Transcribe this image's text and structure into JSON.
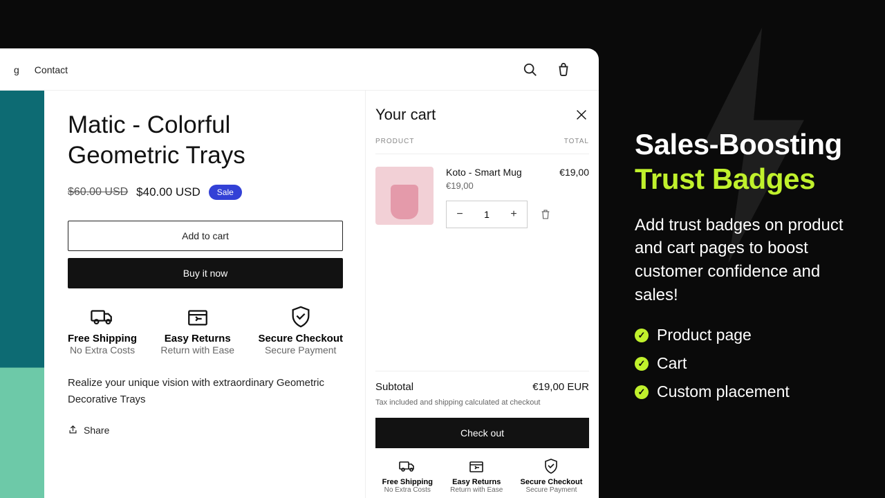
{
  "nav": {
    "links": [
      "g",
      "Contact"
    ]
  },
  "product": {
    "title": "Matic - Colorful Geometric Trays",
    "old_price": "$60.00 USD",
    "new_price": "$40.00 USD",
    "sale_label": "Sale",
    "add_to_cart": "Add to cart",
    "buy_now": "Buy it now",
    "description": "Realize your unique vision with extraordinary Geometric Decorative Trays",
    "share_label": "Share"
  },
  "badges": [
    {
      "title": "Free Shipping",
      "sub": "No Extra Costs"
    },
    {
      "title": "Easy Returns",
      "sub": "Return with Ease"
    },
    {
      "title": "Secure Checkout",
      "sub": "Secure Payment"
    }
  ],
  "cart": {
    "title": "Your cart",
    "col_product": "PRODUCT",
    "col_total": "TOTAL",
    "item": {
      "name": "Koto - Smart Mug",
      "unit_price": "€19,00",
      "line_total": "€19,00",
      "qty": "1"
    },
    "subtotal_label": "Subtotal",
    "subtotal_value": "€19,00 EUR",
    "tax_note": "Tax included and shipping calculated at checkout",
    "checkout_label": "Check out"
  },
  "marketing": {
    "line1": "Sales-Boosting",
    "line2": "Trust Badges",
    "body": "Add trust badges on product and cart pages to boost customer confidence and sales!",
    "features": [
      "Product page",
      "Cart",
      "Custom placement"
    ]
  }
}
